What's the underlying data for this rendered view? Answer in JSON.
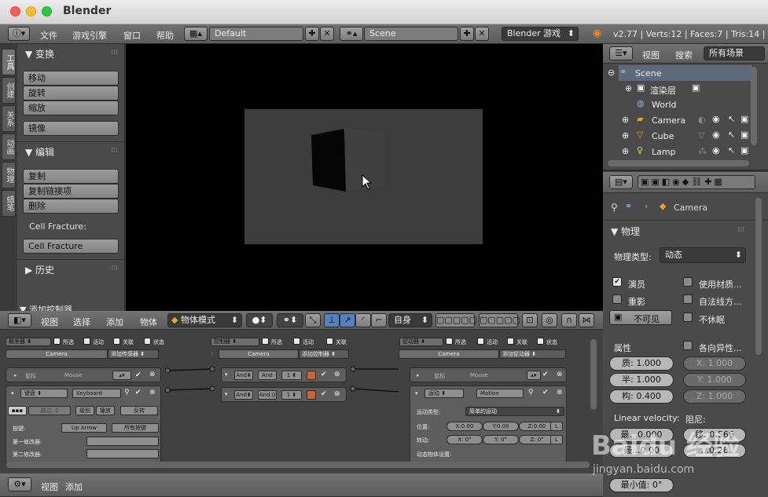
{
  "window": {
    "title": "Blender"
  },
  "info_header": {
    "menus": [
      "文件",
      "游戏引擎",
      "窗口",
      "帮助"
    ],
    "screen_layout": "Default",
    "scene": "Scene",
    "engine": "Blender 游戏",
    "stats": "v2.77 | Verts:12 | Faces:7 | Tris:14 | O"
  },
  "toolshelf": {
    "tabs": [
      "工具",
      "创建",
      "关系",
      "动画",
      "物理",
      "蜡笔"
    ],
    "transform": {
      "title": "变换",
      "buttons": [
        "移动",
        "旋转",
        "缩放",
        "镜像"
      ]
    },
    "edit": {
      "title": "编辑",
      "buttons": [
        "复制",
        "复制链接项",
        "删除"
      ]
    },
    "cell_fracture": {
      "label": "Cell Fracture:",
      "button": "Cell Fracture"
    },
    "history": {
      "title": "历史"
    },
    "add_controller": {
      "title": "添加控制器"
    }
  },
  "view3d_header": {
    "menus": [
      "视图",
      "选择",
      "添加",
      "物体"
    ],
    "mode": "物体模式",
    "orientation": "自身"
  },
  "logic_editor": {
    "sensors": {
      "dropdown": "触发器",
      "options": [
        "所选",
        "活动",
        "关联",
        "状态"
      ],
      "object": "Camera",
      "add": "添加传感器",
      "mouse": {
        "type": "鼠标",
        "name": "Mouse"
      },
      "keyboard": {
        "type": "键盘",
        "name": "Keyboard",
        "skip_label": "跳过:",
        "skip_value": "0",
        "level": "级别",
        "tap": "锤放",
        "invert": "反转",
        "key_label": "按键:",
        "key_value": "Up Arrow",
        "all_keys": "所有按键",
        "mod1": "第一修改器:",
        "mod2": "第二修改器:"
      }
    },
    "controllers": {
      "dropdown": "控制器",
      "options": [
        "所选",
        "活动",
        "关联"
      ],
      "object": "Camera",
      "add": "添加控制器",
      "rows": [
        {
          "type": "And",
          "name": "And",
          "state": "1"
        },
        {
          "type": "And",
          "name": "And.0",
          "state": "1"
        }
      ]
    },
    "actuators": {
      "dropdown": "促动器",
      "options": [
        "所选",
        "活动",
        "关联",
        "状态"
      ],
      "object": "Camera",
      "add": "添加促动器",
      "mouse": {
        "type": "鼠标",
        "name": "Mouse"
      },
      "motion": {
        "type": "运动",
        "name": "Motion",
        "motion_type_label": "运动类型:",
        "motion_type": "简单的运动",
        "loc_label": "位置:",
        "loc": [
          "X:0.00",
          "Y:0.00",
          "Z:0.00"
        ],
        "rot_label": "转动:",
        "rot": [
          "X:  0°",
          "Y:  0°",
          "Z:  0°"
        ],
        "local": "L",
        "dyn_label": "动态物体设置:"
      }
    }
  },
  "logic_header": {
    "menus": [
      "视图",
      "添加"
    ]
  },
  "outliner": {
    "menus": [
      "视图",
      "搜索"
    ],
    "filter": "所有场景",
    "items": [
      {
        "name": "Scene",
        "icon": "scene-icon"
      },
      {
        "name": "渲染层",
        "icon": "render-layer-icon"
      },
      {
        "name": "World",
        "icon": "world-icon"
      },
      {
        "name": "Camera",
        "icon": "camera-icon"
      },
      {
        "name": "Cube",
        "icon": "mesh-icon"
      },
      {
        "name": "Lamp",
        "icon": "lamp-icon"
      }
    ]
  },
  "properties": {
    "breadcrumb_object": "Camera",
    "physics": {
      "title": "物理",
      "type_label": "物理类型:",
      "type": "动态",
      "actor": "演员",
      "use_material": "使用材质...",
      "ghost": "重影",
      "use_normal": "自法线方...",
      "invisible": "不可见",
      "no_sleep": "不休眠",
      "attributes_label": "属性",
      "anisotropic": "各向异性...",
      "mass": "质: 1.000",
      "radius": "半: 1.000",
      "form": "构: 0.400",
      "aniso_x": "X:    1.000",
      "aniso_y": "Y:    1.000",
      "aniso_z": "Z:    1.000",
      "linear_velocity": "Linear velocity:",
      "damping": "阻尼:",
      "min": "最...0.000",
      "damp_trans": "移:  0.566",
      "max": "最...0.00",
      "damp_rot": "...0.26",
      "min_angle": "最小值: 0°"
    }
  },
  "watermark": {
    "brand": "Baidu 经验",
    "url": "jingyan.baidu.com"
  }
}
